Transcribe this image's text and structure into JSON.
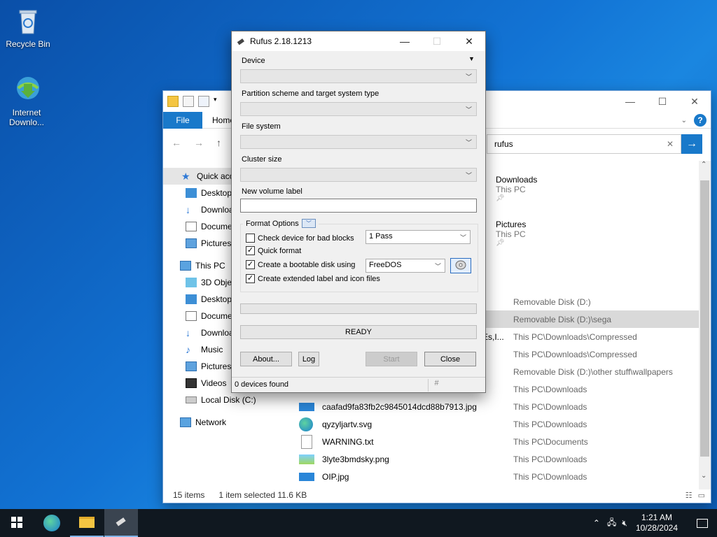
{
  "desktop": {
    "icons": [
      {
        "label": "Recycle Bin",
        "icon": "recycle-bin-icon"
      },
      {
        "label": "Internet Downlo...",
        "icon": "internet-download-manager-icon"
      }
    ]
  },
  "explorer": {
    "ribbon": {
      "file_tab": "File",
      "home_tab": "Home"
    },
    "search": {
      "value": "rufus"
    },
    "nav": [
      {
        "label": "Quick acce",
        "icon": "star-icon",
        "selected": true
      },
      {
        "label": "Desktop",
        "icon": "desktop-icon"
      },
      {
        "label": "Downloa",
        "icon": "download-icon"
      },
      {
        "label": "Docume",
        "icon": "document-icon"
      },
      {
        "label": "Pictures",
        "icon": "pictures-icon"
      },
      {
        "label": "This PC",
        "icon": "computer-icon"
      },
      {
        "label": "3D Objec",
        "icon": "3d-objects-icon"
      },
      {
        "label": "Desktop",
        "icon": "desktop-icon"
      },
      {
        "label": "Docume",
        "icon": "document-icon"
      },
      {
        "label": "Downloa",
        "icon": "download-icon"
      },
      {
        "label": "Music",
        "icon": "music-icon"
      },
      {
        "label": "Pictures",
        "icon": "pictures-icon"
      },
      {
        "label": "Videos",
        "icon": "videos-icon"
      },
      {
        "label": "Local Disk (C:)",
        "icon": "drive-icon"
      },
      {
        "label": "Network",
        "icon": "network-icon"
      }
    ],
    "quick_tiles": [
      {
        "name": "Downloads",
        "sub": "This PC"
      },
      {
        "name": "Pictures",
        "sub": "This PC"
      }
    ],
    "results": [
      {
        "name": "",
        "location": "Removable Disk (D:)",
        "icon": "usb-drive-icon"
      },
      {
        "name": "",
        "location": "Removable Disk (D:)\\sega",
        "icon": "folder-icon",
        "selected": true
      },
      {
        "name": "Es,I...",
        "location": "This PC\\Downloads\\Compressed",
        "icon": "file-icon"
      },
      {
        "name": "",
        "location": "This PC\\Downloads\\Compressed",
        "icon": "file-icon"
      },
      {
        "name": "",
        "location": "Removable Disk (D:)\\other stuff\\wallpapers",
        "icon": "image-icon"
      },
      {
        "name": "",
        "location": "This PC\\Downloads",
        "icon": "image-icon"
      },
      {
        "name": "caafad9fa83fb2c9845014dcd88b7913.jpg",
        "location": "This PC\\Downloads",
        "icon": "image-icon"
      },
      {
        "name": "qyzyljartv.svg",
        "location": "This PC\\Downloads",
        "icon": "edge-icon"
      },
      {
        "name": "WARNING.txt",
        "location": "This PC\\Documents",
        "icon": "text-file-icon"
      },
      {
        "name": "3lyte3bmdsky.png",
        "location": "This PC\\Downloads",
        "icon": "image-icon"
      },
      {
        "name": "OIP.jpg",
        "location": "This PC\\Downloads",
        "icon": "image-icon"
      }
    ],
    "status": {
      "items": "15 items",
      "selected": "1 item selected  11.6 KB"
    }
  },
  "rufus": {
    "title": "Rufus 2.18.1213",
    "device_label": "Device",
    "partition_label": "Partition scheme and target system type",
    "filesystem_label": "File system",
    "cluster_label": "Cluster size",
    "volume_label": "New volume label",
    "format_options": "Format Options",
    "check_bad_blocks": {
      "label": "Check device for bad blocks",
      "checked": false,
      "passes": "1 Pass"
    },
    "quick_format": {
      "label": "Quick format",
      "checked": true
    },
    "bootable": {
      "label": "Create a bootable disk using",
      "checked": true,
      "value": "FreeDOS"
    },
    "extended_label": {
      "label": "Create extended label and icon files",
      "checked": true
    },
    "status": "READY",
    "buttons": {
      "about": "About...",
      "log": "Log",
      "start": "Start",
      "close": "Close"
    },
    "footer": {
      "devices": "0 devices found",
      "hash": "#"
    }
  },
  "taskbar": {
    "clock_time": "1:21 AM",
    "clock_date": "10/28/2024"
  }
}
